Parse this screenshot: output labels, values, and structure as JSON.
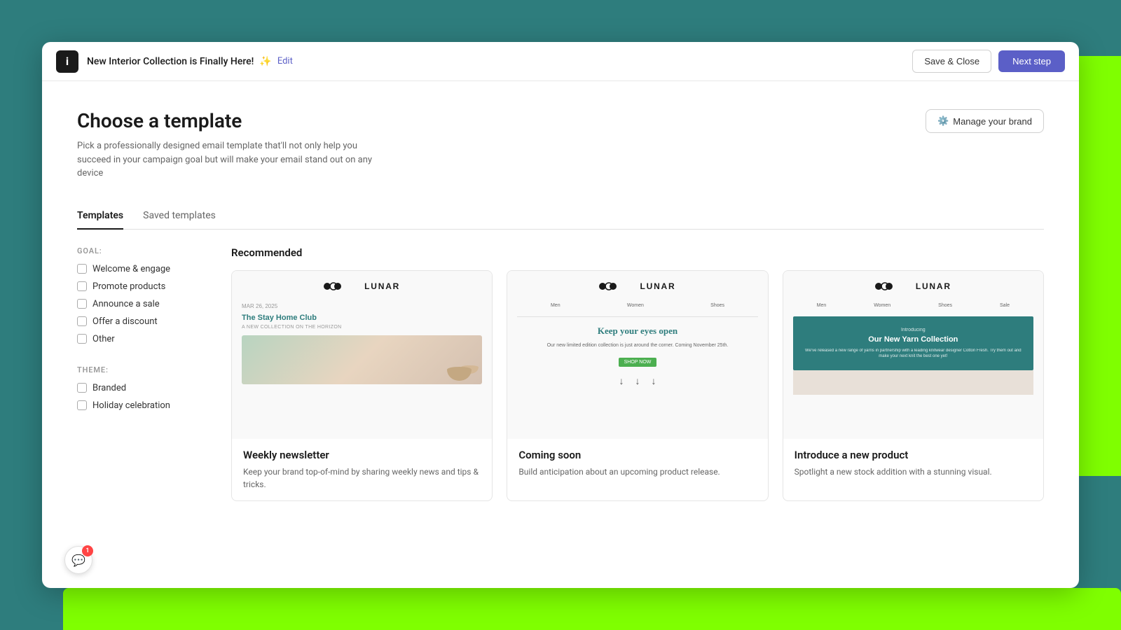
{
  "background": {
    "color": "#2e7d7d",
    "accent_color": "#7fff00"
  },
  "topbar": {
    "logo_text": "i",
    "campaign_title": "New Interior Collection is Finally Here!",
    "sparkle_emoji": "✨",
    "edit_label": "Edit",
    "save_close_label": "Save & Close",
    "next_step_label": "Next step"
  },
  "page": {
    "heading": "Choose a template",
    "description": "Pick a professionally designed email template that'll not only help you succeed in your campaign goal but will make your email stand out on any device",
    "manage_brand_label": "Manage your brand"
  },
  "tabs": [
    {
      "label": "Templates",
      "active": true
    },
    {
      "label": "Saved templates",
      "active": false
    }
  ],
  "sidebar": {
    "goal_label": "GOAL:",
    "goals": [
      {
        "label": "Welcome & engage",
        "checked": false
      },
      {
        "label": "Promote products",
        "checked": false
      },
      {
        "label": "Announce a sale",
        "checked": false
      },
      {
        "label": "Offer a discount",
        "checked": false
      },
      {
        "label": "Other",
        "checked": false
      }
    ],
    "theme_label": "THEME:",
    "themes": [
      {
        "label": "Branded",
        "checked": false
      },
      {
        "label": "Holiday celebration",
        "checked": false
      }
    ]
  },
  "templates_section": {
    "section_title": "Recommended",
    "templates": [
      {
        "id": "weekly-newsletter",
        "name": "Weekly newsletter",
        "description": "Keep your brand top-of-mind by sharing weekly news and tips & tricks.",
        "preview": {
          "brand": "LUNAR",
          "date": "MAR 26, 2025",
          "headline": "The Stay Home Club",
          "subheading": "A NEW COLLECTION ON THE HORIZON"
        }
      },
      {
        "id": "coming-soon",
        "name": "Coming soon",
        "description": "Build anticipation about an upcoming product release.",
        "preview": {
          "brand": "LUNAR",
          "nav_items": [
            "Men",
            "Women",
            "Shoes"
          ],
          "headline": "Keep your eyes open",
          "body": "Our new limited edition collection is just around the corner. Coming November 25th.",
          "cta": "SHOP NOW"
        }
      },
      {
        "id": "introduce-product",
        "name": "Introduce a new product",
        "description": "Spotlight a new stock addition with a stunning visual.",
        "preview": {
          "brand": "LUNAR",
          "nav_items": [
            "Men",
            "Women",
            "Shoes",
            "Sale"
          ],
          "introducing_label": "Introducing",
          "headline": "Our New Yarn Collection",
          "body": "We've released a new range of yarns in partnership with a leading knitwear designer Cotton Fresh. Try them out and make your next knit the best one yet!"
        }
      }
    ]
  },
  "chat": {
    "badge_count": "1"
  }
}
